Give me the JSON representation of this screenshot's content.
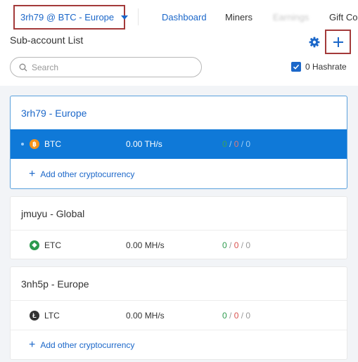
{
  "header": {
    "account_selector": "3rh79 @ BTC - Europe",
    "nav": [
      "Dashboard",
      "Miners",
      "Earnings",
      "Gift Coin"
    ]
  },
  "page": {
    "title": "Sub-account List",
    "search_placeholder": "Search",
    "hashrate_label": "0 Hashrate",
    "hashrate_checked": true
  },
  "colors": {
    "accent": "#1b67c9",
    "highlight_row": "#0f79d8",
    "highlight_box": "#a33a3a",
    "active_green": "#2e9b4e",
    "inactive_red": "#d9534f"
  },
  "add_crypto_label": "Add other cryptocurrency",
  "subaccounts": [
    {
      "name": "3rh79 - Europe",
      "coin": {
        "symbol": "BTC",
        "icon": "bitcoin-icon",
        "hashrate": "0.00 TH/s",
        "active": "0",
        "inactive": "0",
        "offline": "0"
      }
    },
    {
      "name": "jmuyu - Global",
      "coin": {
        "symbol": "ETC",
        "icon": "ethereum-classic-icon",
        "hashrate": "0.00 MH/s",
        "active": "0",
        "inactive": "0",
        "offline": "0"
      }
    },
    {
      "name": "3nh5p - Europe",
      "coin": {
        "symbol": "LTC",
        "icon": "litecoin-icon",
        "hashrate": "0.00 MH/s",
        "active": "0",
        "inactive": "0",
        "offline": "0"
      }
    }
  ]
}
